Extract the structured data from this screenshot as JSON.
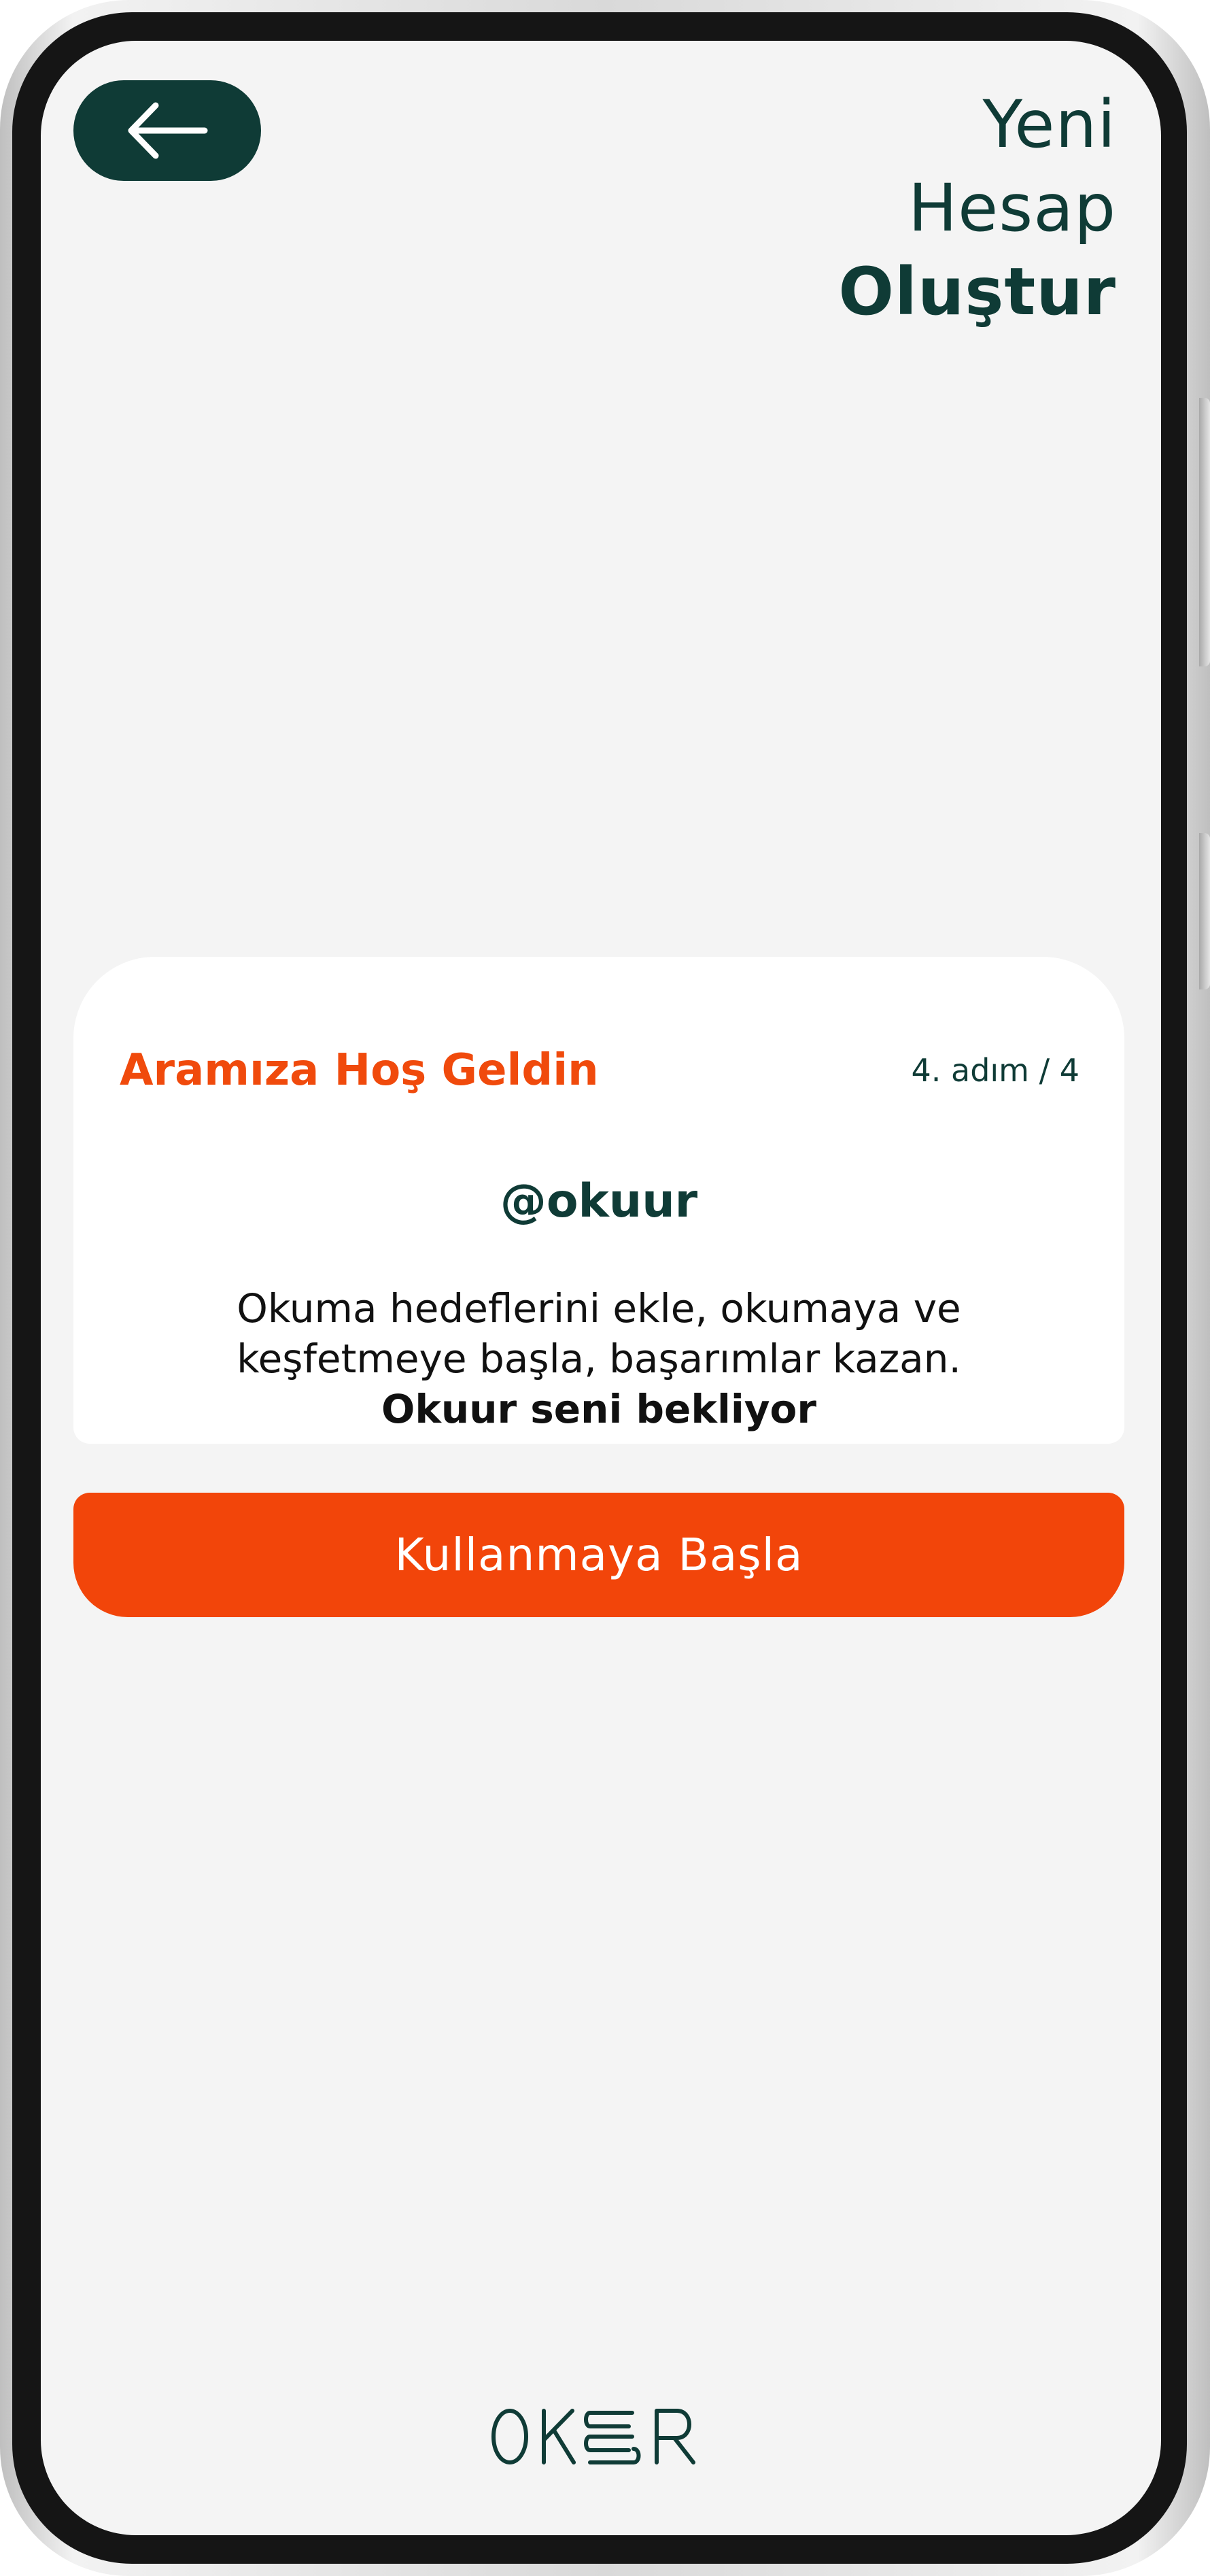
{
  "header": {
    "back_icon": "arrow-left-icon",
    "title_lines": [
      "Yeni",
      "Hesap",
      "Oluştur"
    ]
  },
  "card": {
    "heading": "Aramıza Hoş Geldin",
    "step": "4. adım / 4",
    "username": "@okuur",
    "body_lines": [
      "Okuma hedeflerini ekle, okumaya ve",
      "keşfetmeye başla, başarımlar kazan.",
      "Okuur seni bekliyor"
    ]
  },
  "actions": {
    "start_label": "Kullanmaya Başla"
  },
  "logo": {
    "text": "OKUUR"
  },
  "colors": {
    "primary_dark": "#0f3b36",
    "accent_orange": "#f2450a",
    "background": "#f4f4f4",
    "card": "#ffffff"
  }
}
